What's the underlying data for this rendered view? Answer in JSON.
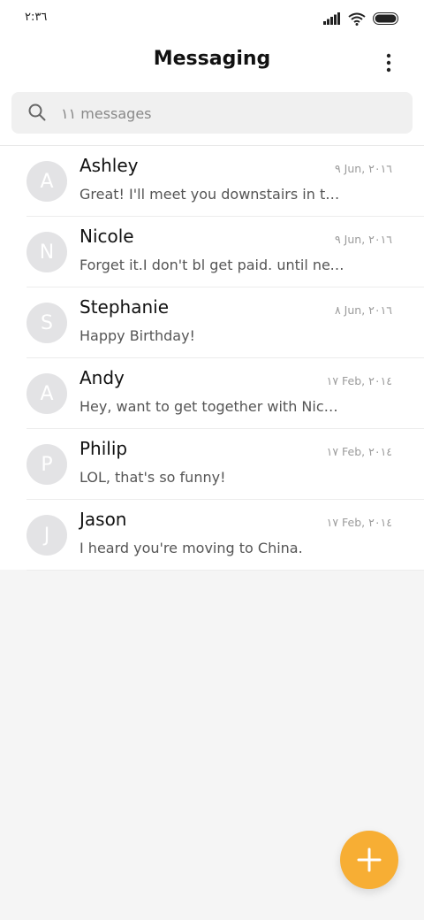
{
  "status_bar": {
    "time": "٢:٣٦",
    "icons": [
      "signal-icon",
      "wifi-icon",
      "battery-icon"
    ]
  },
  "header": {
    "title": "Messaging",
    "menu_icon": "more-vertical-icon"
  },
  "search": {
    "placeholder": "١١ messages",
    "icon": "search-icon"
  },
  "conversations": [
    {
      "initial": "A",
      "name": "Ashley",
      "date": "٩ Jun, ٢٠١٦",
      "preview": "Great! I'll meet you downstairs in ten minutes."
    },
    {
      "initial": "N",
      "name": "Nicole",
      "date": "٩ Jun, ٢٠١٦",
      "preview": "Forget it.I don't bl get paid. until next week."
    },
    {
      "initial": "S",
      "name": "Stephanie",
      "date": "٨ Jun, ٢٠١٦",
      "preview": "Happy Birthday!"
    },
    {
      "initial": "A",
      "name": "Andy",
      "date": "١٧ Feb, ٢٠١٤",
      "preview": "Hey, want to get together with Nicole tonight?"
    },
    {
      "initial": "P",
      "name": "Philip",
      "date": "١٧ Feb, ٢٠١٤",
      "preview": "LOL, that's so funny!"
    },
    {
      "initial": "J",
      "name": "Jason",
      "date": "١٧ Feb, ٢٠١٤",
      "preview": "I heard you're moving to China."
    }
  ],
  "fab": {
    "icon": "plus-icon"
  },
  "colors": {
    "accent": "#f7ae34",
    "avatar": "#e3e3e5",
    "background": "#f5f5f5"
  }
}
